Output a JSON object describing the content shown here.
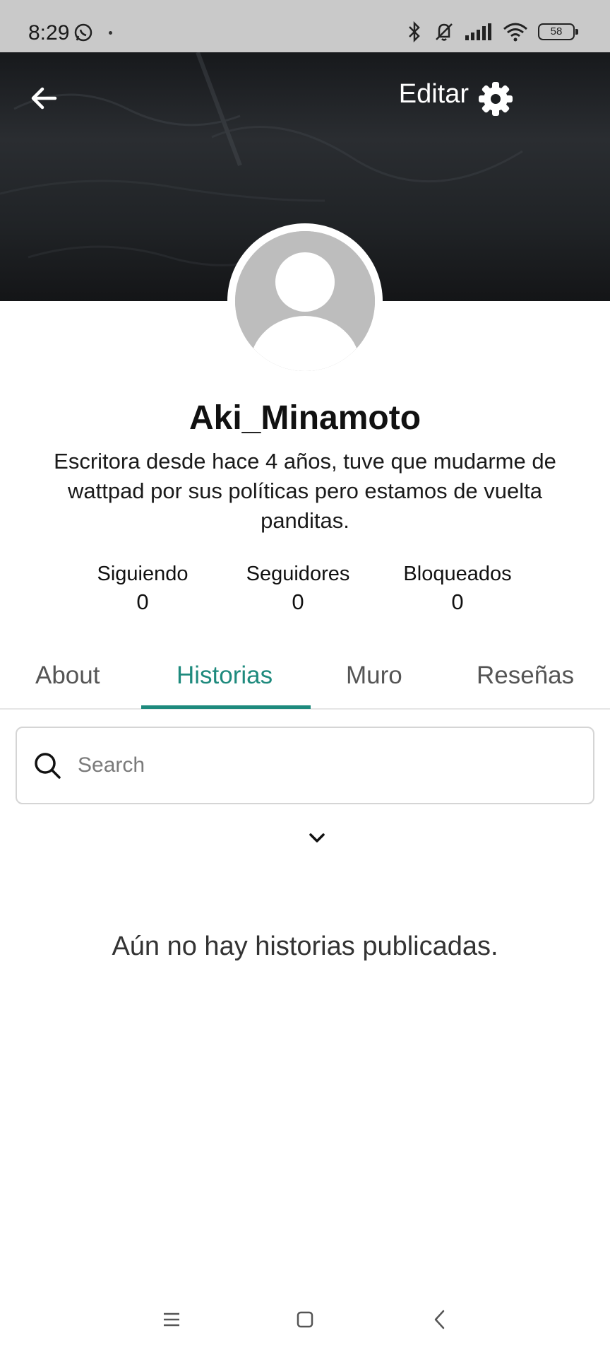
{
  "status_bar": {
    "time": "8:29",
    "battery": "58",
    "icons": [
      "whatsapp-icon",
      "bluetooth-icon",
      "mute-icon",
      "signal-icon",
      "wifi-icon",
      "battery-icon"
    ]
  },
  "header": {
    "edit_label": "Editar"
  },
  "profile": {
    "username": "Aki_Minamoto",
    "bio": "Escritora desde hace 4 años, tuve que mudarme de wattpad por sus políticas pero estamos de vuelta panditas."
  },
  "stats": [
    {
      "label": "Siguiendo",
      "value": "0"
    },
    {
      "label": "Seguidores",
      "value": "0"
    },
    {
      "label": "Bloqueados",
      "value": "0"
    }
  ],
  "tabs": [
    {
      "label": "About",
      "active": false
    },
    {
      "label": "Historias",
      "active": true
    },
    {
      "label": "Muro",
      "active": false
    },
    {
      "label": "Reseñas",
      "active": false
    }
  ],
  "search": {
    "placeholder": "Search",
    "value": ""
  },
  "empty_message": "Aún no hay historias publicadas.",
  "colors": {
    "accent": "#1e8a7d",
    "status_bar": "#c9c9c9",
    "cover": "#1c1e21"
  }
}
